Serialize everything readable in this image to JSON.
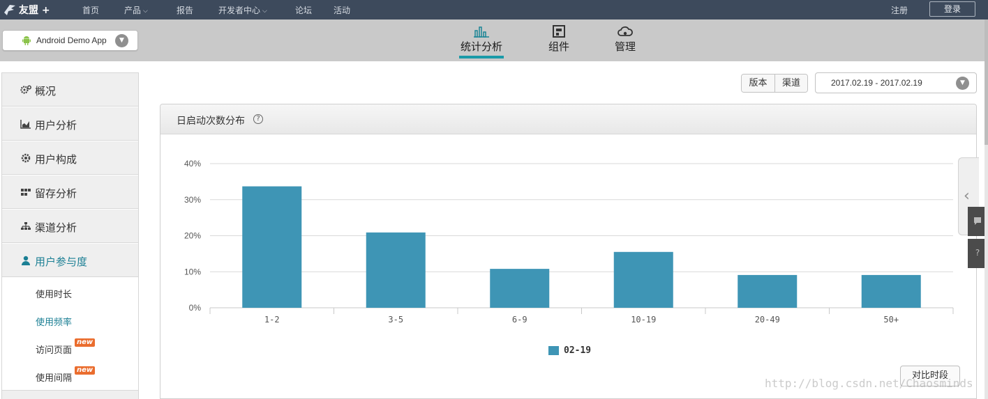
{
  "topnav": {
    "logo_text": "友盟 +",
    "items": [
      {
        "label": "首页",
        "dropdown": false
      },
      {
        "label": "产品",
        "dropdown": true
      },
      {
        "label": "报告",
        "dropdown": false
      },
      {
        "label": "开发者中心",
        "dropdown": true
      },
      {
        "label": "论坛",
        "dropdown": false
      },
      {
        "label": "活动",
        "dropdown": false
      }
    ],
    "register": "注册",
    "login": "登录"
  },
  "app_selector": {
    "app_name": "Android Demo App",
    "icon": "android-icon"
  },
  "main_tabs": [
    {
      "label": "统计分析",
      "icon": "bar-chart-icon",
      "active": true
    },
    {
      "label": "组件",
      "icon": "component-icon",
      "active": false
    },
    {
      "label": "管理",
      "icon": "cloud-gear-icon",
      "active": false
    }
  ],
  "sidebar": {
    "items": [
      {
        "label": "概况",
        "icon": "gears-icon"
      },
      {
        "label": "用户分析",
        "icon": "area-chart-icon"
      },
      {
        "label": "用户构成",
        "icon": "gear-icon"
      },
      {
        "label": "留存分析",
        "icon": "grid-icon"
      },
      {
        "label": "渠道分析",
        "icon": "sitemap-icon"
      },
      {
        "label": "用户参与度",
        "icon": "user-icon",
        "active": true
      }
    ],
    "sub_items": [
      {
        "label": "使用时长",
        "new": false
      },
      {
        "label": "使用频率",
        "new": false,
        "active": true
      },
      {
        "label": "访问页面",
        "new": true
      },
      {
        "label": "使用间隔",
        "new": true
      }
    ],
    "new_badge": "new"
  },
  "filters": {
    "version": "版本",
    "channel": "渠道",
    "date_range": "2017.02.19 - 2017.02.19"
  },
  "panel": {
    "title": "日启动次数分布",
    "help": "?"
  },
  "chart_data": {
    "type": "bar",
    "categories": [
      "1-2",
      "3-5",
      "6-9",
      "10-19",
      "20-49",
      "50+"
    ],
    "series": [
      {
        "name": "02-19",
        "values": [
          33.7,
          20.9,
          10.8,
          15.5,
          9.1,
          9.1
        ]
      }
    ],
    "yticks": [
      "0%",
      "10%",
      "20%",
      "30%",
      "40%"
    ],
    "ylim": [
      0,
      40
    ],
    "grid": true,
    "legend": "bottom-center",
    "bar_color": "#3e95b5"
  },
  "compare_button": "对比时段",
  "watermark": "http://blog.csdn.net/Chaosminds"
}
